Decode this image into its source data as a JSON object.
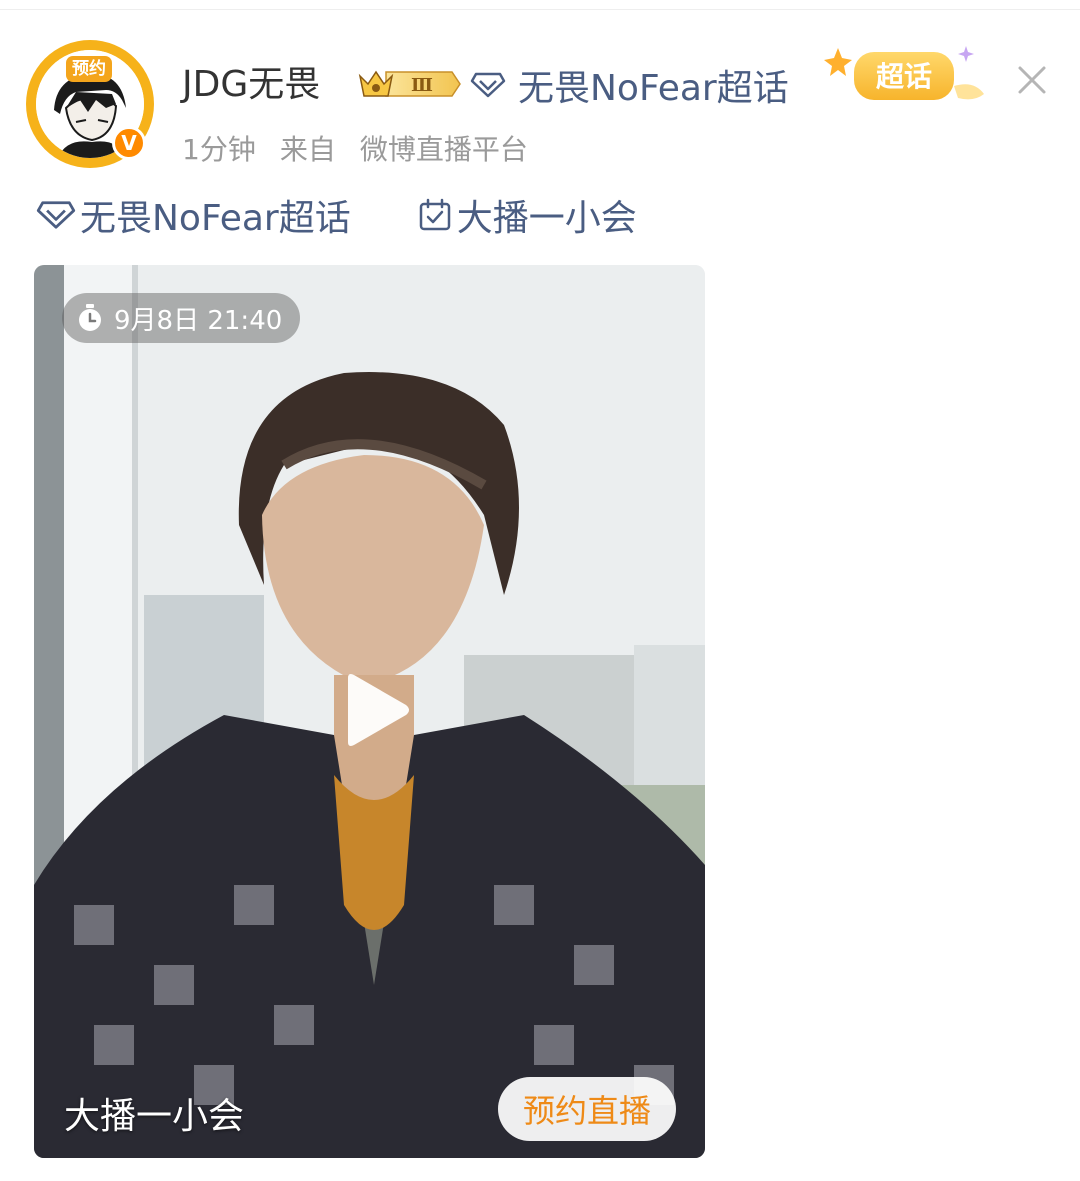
{
  "post": {
    "avatar_badge": "预约",
    "verified_mark": "V",
    "user_name": "JDG无畏",
    "level_badge": "Ⅲ",
    "topic_name": "无畏NoFear超话",
    "chaohua_badge": "超话",
    "time": "1分钟",
    "source_prefix": "来自",
    "source": "微博直播平台"
  },
  "tags": {
    "topic": "无畏NoFear超话",
    "event": "大播一小会"
  },
  "live_card": {
    "scheduled_time": "9月8日 21:40",
    "title": "大播一小会",
    "reserve_label": "预约直播"
  },
  "colors": {
    "link": "#4a5d82",
    "accent_orange": "#ee8a17",
    "avatar_ring": "#f6b21a"
  }
}
